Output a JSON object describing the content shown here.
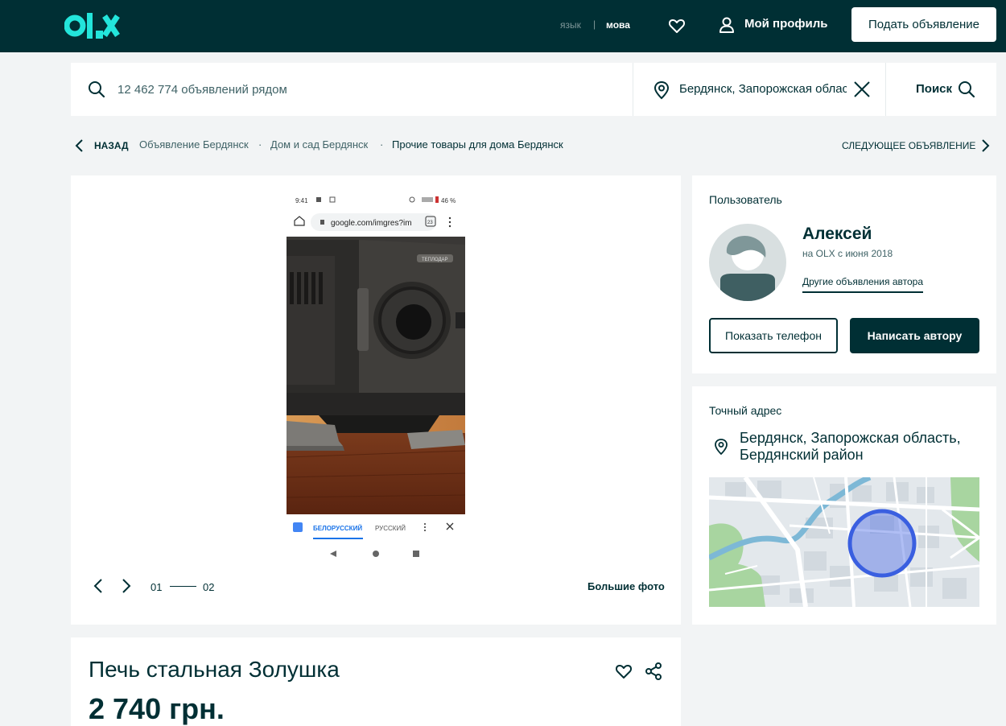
{
  "header": {
    "logo_text": "OLX",
    "lang_ru": "язык",
    "lang_sep": "|",
    "lang_ua": "мова",
    "profile_label": "Мой профиль",
    "post_button": "Подать объявление"
  },
  "search": {
    "placeholder": "12 462 774 объявлений рядом",
    "location": "Бердянск, Запорожская область",
    "search_button": "Поиск"
  },
  "breadcrumbs": {
    "back": "НАЗАД",
    "items": [
      "Объявление Бердянск",
      "Дом и сад Бердянск",
      "Прочие товары для дома Бердянск"
    ],
    "separator": "·",
    "next_ad": "СЛЕДУЮЩЕЕ ОБЪЯВЛЕНИЕ"
  },
  "gallery": {
    "current": "01",
    "total": "02",
    "big_photos": "Большие фото",
    "screenshot": {
      "time": "9:41",
      "battery": "46 %",
      "url": "google.com/imgres?im",
      "tabs_count": "23",
      "brand_plate": "ТЕПЛОДАР",
      "lang_active": "БЕЛОРУССКИЙ",
      "lang_other": "РУССКИЙ"
    }
  },
  "ad": {
    "title": "Печь стальная Золушка",
    "price": "2 740 грн."
  },
  "user": {
    "section_label": "Пользователь",
    "name": "Алексей",
    "since": "на OLX с июня 2018",
    "other_ads": "Другие объявления автора",
    "show_phone": "Показать телефон",
    "write": "Написать автору"
  },
  "address": {
    "section_label": "Точный адрес",
    "line1": "Бердянск, Запорожская область,",
    "line2": "Бердянский район"
  },
  "colors": {
    "brand_dark": "#002f34",
    "brand_teal": "#23e5db",
    "page_bg": "#f2f4f5"
  }
}
